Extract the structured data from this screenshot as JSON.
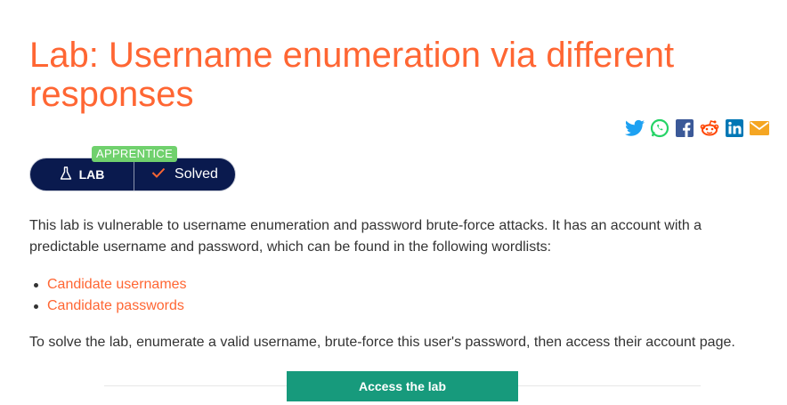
{
  "page": {
    "title": "Lab: Username enumeration via different responses"
  },
  "share": {
    "icons": [
      "twitter-icon",
      "whatsapp-icon",
      "facebook-icon",
      "reddit-icon",
      "linkedin-icon",
      "email-icon"
    ],
    "colors": {
      "twitter": "#1da1f2",
      "whatsapp": "#25d366",
      "facebook": "#3b5998",
      "reddit": "#ff4500",
      "linkedin": "#0077b5",
      "email": "#f5a623"
    }
  },
  "badge": {
    "level": "APPRENTICE",
    "lab_label": "LAB",
    "status": "Solved"
  },
  "content": {
    "description": "This lab is vulnerable to username enumeration and password brute-force attacks. It has an account with a predictable username and password, which can be found in the following wordlists:",
    "wordlists": [
      "Candidate usernames",
      "Candidate passwords"
    ],
    "goal": "To solve the lab, enumerate a valid username, brute-force this user's password, then access their account page."
  },
  "actions": {
    "access_label": "Access the lab"
  },
  "colors": {
    "accent": "#ff6633",
    "navy": "#0a1a4e",
    "level_green": "#70d16d",
    "button_green": "#179a7c"
  }
}
